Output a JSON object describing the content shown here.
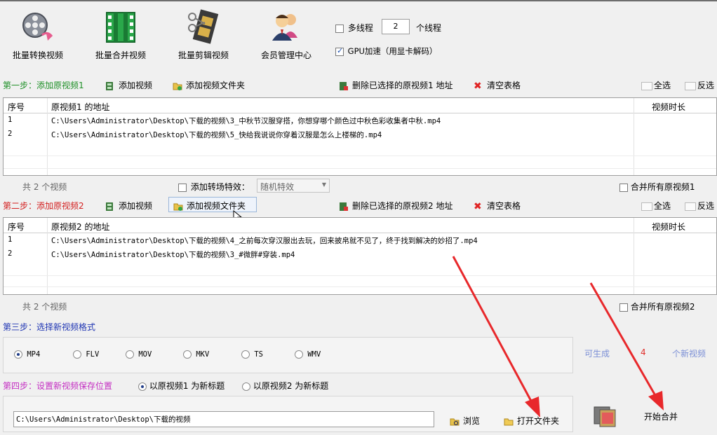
{
  "toolbar": {
    "batch_convert": "批量转换视频",
    "batch_merge": "批量合并视频",
    "batch_clip": "批量剪辑视频",
    "member_center": "会员管理中心"
  },
  "options": {
    "multithread_label": "多线程",
    "thread_count": "2",
    "thread_unit": "个线程",
    "gpu_label": "GPU加速（用显卡解码）"
  },
  "step1": {
    "title": "第一步：添加原视频1",
    "add_video": "添加视频",
    "add_folder": "添加视频文件夹",
    "delete_selected": "删除已选择的原视频1 地址",
    "clear_table": "清空表格",
    "select_all": "全选",
    "invert": "反选",
    "columns": [
      "序号",
      "原视频1 的地址",
      "视频时长"
    ],
    "rows": [
      {
        "index": "1",
        "path": "C:\\Users\\Administrator\\Desktop\\下载的视频\\3_中秋节汉服穿搭，你想穿哪个颜色过中秋色彩收集者中秋.mp4",
        "duration": ""
      },
      {
        "index": "2",
        "path": "C:\\Users\\Administrator\\Desktop\\下载的视频\\5_快给我说说你穿着汉服是怎么上楼梯的.mp4",
        "duration": ""
      }
    ],
    "count_text": "共 2 个视频",
    "transition_label": "添加转场特效：",
    "transition_value": "随机特效",
    "merge_all": "合并所有原视频1"
  },
  "step2": {
    "title": "第二步：添加原视频2",
    "add_video": "添加视频",
    "add_folder": "添加视频文件夹",
    "delete_selected": "删除已选择的原视频2 地址",
    "clear_table": "清空表格",
    "select_all": "全选",
    "invert": "反选",
    "columns": [
      "序号",
      "原视频2 的地址",
      "视频时长"
    ],
    "rows": [
      {
        "index": "1",
        "path": "C:\\Users\\Administrator\\Desktop\\下载的视频\\4_之前每次穿汉服出去玩，回来披帛就不见了，终于找到解决的妙招了.mp4",
        "duration": ""
      },
      {
        "index": "2",
        "path": "C:\\Users\\Administrator\\Desktop\\下载的视频\\3_#微胖#穿装.mp4",
        "duration": ""
      }
    ],
    "count_text": "共 2 个视频",
    "merge_all": "合并所有原视频2"
  },
  "step3": {
    "title": "第三步：选择新视频格式",
    "formats": [
      "MP4",
      "FLV",
      "MOV",
      "MKV",
      "TS",
      "WMV"
    ],
    "selected": "MP4",
    "can_generate": "可生成",
    "count": "4",
    "unit": "个新视频"
  },
  "step4": {
    "title": "第四步：设置新视频保存位置",
    "title_option1": "以原视频1 为新标题",
    "title_option2": "以原视频2 为新标题",
    "save_path": "C:\\Users\\Administrator\\Desktop\\下载的视频",
    "browse": "浏览",
    "open_folder": "打开文件夹",
    "start_merge": "开始合并"
  },
  "colors": {
    "step_green": "#1d8f26",
    "step_red": "#d31f1f",
    "step_blue": "#1f35b3",
    "step_magenta": "#c42ec2",
    "annotation_arrow": "#e8282b"
  }
}
